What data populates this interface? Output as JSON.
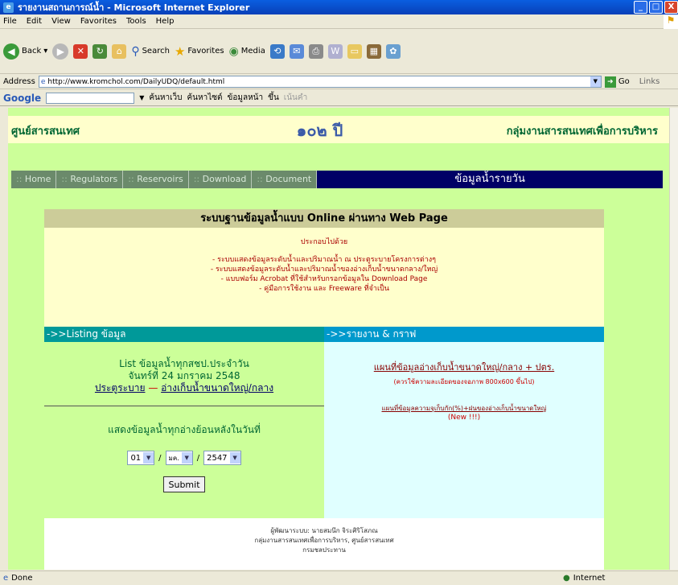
{
  "window": {
    "title": "รายงานสถานการณ์น้ำ - Microsoft Internet Explorer",
    "min": "_",
    "max": "□",
    "close": "X"
  },
  "menu": [
    "File",
    "Edit",
    "View",
    "Favorites",
    "Tools",
    "Help"
  ],
  "toolbar": {
    "back": "Back",
    "search": "Search",
    "favorites": "Favorites",
    "media": "Media"
  },
  "address": {
    "label": "Address",
    "url": "http://www.kromchol.com/DailyUDQ/default.html",
    "go": "Go",
    "links": "Links"
  },
  "google": {
    "brand": "Google",
    "web_search": "ค้นหาเว็บ",
    "site_search": "ค้นหาไซต์",
    "page_info": "ข้อมูลหน้า",
    "up": "ขึ้น",
    "highlight": "เน้นคำ"
  },
  "page": {
    "header_left": "ศูนย์สารสนเทศ",
    "header_logo": "๑๐๒ ปี",
    "header_right": "กลุ่มงานสารสนเทศเพื่อการบริหาร",
    "nav": [
      {
        "label": "Home"
      },
      {
        "label": "Regulators"
      },
      {
        "label": "Reservoirs"
      },
      {
        "label": "Download"
      },
      {
        "label": "Document"
      }
    ],
    "nav_selected": "ข้อมูลน้ำรายวัน",
    "box_title": "ระบบฐานข้อมูลน้ำแบบ Online ผ่านทาง Web Page",
    "intro": [
      "ประกอบไปด้วย",
      "- ระบบแสดงข้อมูลระดับน้ำและปริมาณน้ำ ณ ประตูระบายโครงการต่างๆ",
      "- ระบบแสดงข้อมูลระดับน้ำและปริมาณน้ำของอ่างเก็บน้ำขนาดกลาง/ใหญ่",
      "- แบบฟอร์ม Acrobat ที่ใช้สำหรับกรอกข้อมูลใน Download Page",
      "- คู่มือการใช้งาน และ Freeware ที่จำเป็น"
    ],
    "section_left": "->>Listing ข้อมูล",
    "section_right": "->>รายงาน & กราฟ",
    "list_line1": "List ข้อมูลน้ำทุกสชป.ประจำวัน",
    "list_line2": "จันทร์ที่ 24 มกราคม 2548",
    "link_gate": "ประตูระบาย",
    "link_sep": " — ",
    "link_reservoir": "อ่างเก็บน้ำขนาดใหญ่/กลาง",
    "history_title": "แสดงข้อมูลน้ำทุกอ่างย้อนหลังในวันที่",
    "day": "01",
    "month": "มค.",
    "year": "2547",
    "slash": "/",
    "submit": "Submit",
    "map1": "แผนที่ข้อมูลอ่างเก็บน้ำขนาดใหญ่/กลาง + ปตร.",
    "map1_note": "(ควรใช้ความละเอียดของจอภาพ 800x600 ขึ้นไป)",
    "map2": "แผนที่ข้อมูลความจุเก็บกัก(%)+ฝนของอ่างเก็บน้ำขนาดใหญ่",
    "map2_note": "(New !!!)",
    "footer": [
      "ผู้พัฒนาระบบ: นายสมนึก จิระศิริโสภณ",
      "กลุ่มงานสารสนเทศเพื่อการบริหาร, ศูนย์สารสนเทศ",
      "กรมชลประทาน"
    ]
  },
  "status": {
    "left": "Done",
    "right": "Internet"
  }
}
